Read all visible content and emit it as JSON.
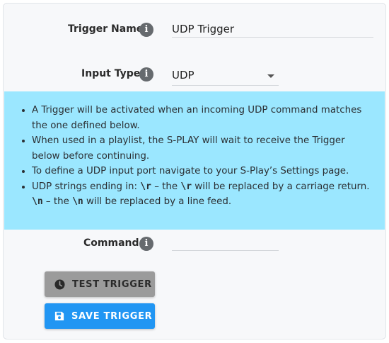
{
  "form": {
    "trigger_name": {
      "label": "Trigger Name",
      "value": "UDP Trigger"
    },
    "input_type": {
      "label": "Input Type",
      "selected": "UDP"
    },
    "command": {
      "label": "Command",
      "value": ""
    }
  },
  "info": {
    "bullet1": "A Trigger will be activated when an incoming UDP command matches the one defined below.",
    "bullet2": "When used in a playlist, the S-PLAY will wait to receive the Trigger below before continuing.",
    "bullet3": "To define a UDP input port navigate to your S-Play’s Settings page.",
    "bullet4_a": "UDP strings ending in: ",
    "bullet4_code1": "\\r",
    "bullet4_b": " – the ",
    "bullet4_code2": "\\r",
    "bullet4_c": " will be replaced by a carriage return. ",
    "bullet4_code3": "\\n",
    "bullet4_d": " – the ",
    "bullet4_code4": "\\n",
    "bullet4_e": " will be replaced by a line feed."
  },
  "buttons": {
    "test_label": "TEST TRIGGER",
    "save_label": "SAVE TRIGGER"
  },
  "colors": {
    "info_background": "#9be7ff",
    "save_button": "#2196f3",
    "test_button": "#9b9b9b"
  }
}
